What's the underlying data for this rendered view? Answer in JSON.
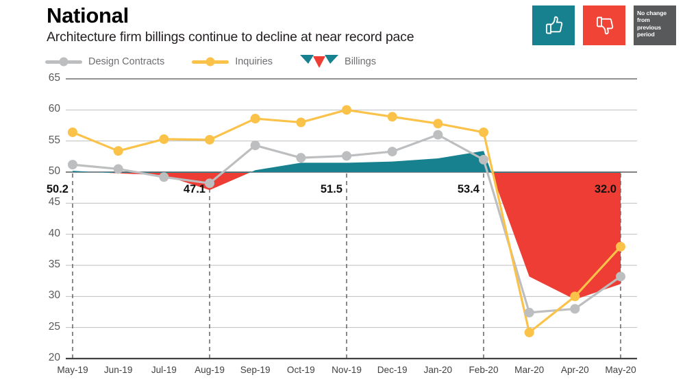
{
  "header": {
    "title": "National",
    "subtitle": "Architecture firm billings continue to decline at near record pace"
  },
  "badges": [
    {
      "name": "thumbs-up",
      "icon": "thumbs-up-icon",
      "color": "#17818f",
      "text": ""
    },
    {
      "name": "thumbs-down",
      "icon": "thumbs-down-icon",
      "color": "#f04437",
      "text": ""
    },
    {
      "name": "no-change",
      "icon": "no-change-icon",
      "color": "#58595b",
      "text": "No change from previous period"
    }
  ],
  "legend": [
    {
      "label": "Design Contracts",
      "color": "#bcbec0",
      "marker": "line-dot"
    },
    {
      "label": "Inquiries",
      "color": "#fbc249",
      "marker": "line-dot"
    },
    {
      "label": "Billings",
      "color": "#17818f",
      "marker": "triangles"
    }
  ],
  "chart_data": {
    "type": "line",
    "title": "National",
    "subtitle": "Architecture firm billings continue to decline at near record pace",
    "xlabel": "",
    "ylabel": "",
    "ylim": [
      20,
      65
    ],
    "yticks": [
      20,
      25,
      30,
      35,
      40,
      45,
      50,
      55,
      60,
      65
    ],
    "grid": true,
    "baseline": 50,
    "legend_position": "top-left",
    "x": [
      "May-19",
      "Jun-19",
      "Jul-19",
      "Aug-19",
      "Sep-19",
      "Oct-19",
      "Nov-19",
      "Dec-19",
      "Jan-20",
      "Feb-20",
      "Mar-20",
      "Apr-20",
      "May-20"
    ],
    "series": [
      {
        "name": "Design Contracts",
        "color": "#bcbec0",
        "values": [
          51.2,
          50.5,
          49.2,
          48.2,
          54.3,
          52.3,
          52.6,
          53.3,
          56.0,
          52.0,
          27.4,
          28.0,
          33.2
        ]
      },
      {
        "name": "Inquiries",
        "color": "#fbc249",
        "values": [
          56.4,
          53.4,
          55.3,
          55.2,
          58.6,
          58.0,
          60.0,
          58.9,
          57.8,
          56.4,
          24.2,
          30.0,
          38.0
        ]
      },
      {
        "name": "Billings",
        "color_above": "#17818f",
        "color_below": "#ee3d34",
        "values": [
          50.2,
          49.8,
          49.5,
          47.1,
          50.3,
          51.5,
          51.5,
          51.7,
          52.2,
          53.4,
          33.2,
          29.5,
          32.0
        ]
      }
    ],
    "annotations": [
      {
        "label": "50.2",
        "x": "May-19",
        "value": 50.2
      },
      {
        "label": "47.1",
        "x": "Aug-19",
        "value": 47.1
      },
      {
        "label": "51.5",
        "x": "Nov-19",
        "value": 51.5
      },
      {
        "label": "53.4",
        "x": "Feb-20",
        "value": 53.4
      },
      {
        "label": "32.0",
        "x": "May-20",
        "value": 32.0
      }
    ]
  }
}
